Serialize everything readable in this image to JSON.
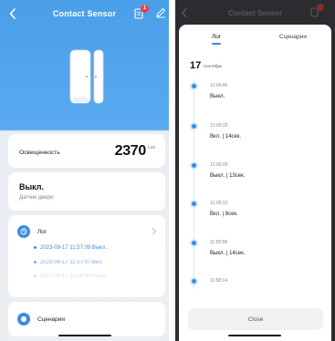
{
  "left": {
    "header": {
      "title": "Contact Sensor",
      "badge": "1"
    },
    "illuminance": {
      "label": "Освещенность",
      "value": "2370",
      "unit": "Lux"
    },
    "state": {
      "value": "Выкл.",
      "subtitle": "Датчик двери"
    },
    "log": {
      "label": "Лог",
      "entries": [
        "2023-09-17 11:57:09 Выкл.",
        "2023-09-17 11:57:07 Вкл.",
        "2023-09-17 11:56:50 Выкл."
      ]
    },
    "scenarios": {
      "label": "Сценарии"
    }
  },
  "right": {
    "dim_title": "Contact Sensor",
    "tabs": {
      "log": "Лог",
      "scenarios": "Сценарии"
    },
    "date": {
      "day": "17",
      "month": "Сентябрь"
    },
    "timeline": [
      {
        "time": "12:00:46",
        "text": "Выкл."
      },
      {
        "time": "12:00:33",
        "text": "Вкл. | 14сек."
      },
      {
        "time": "12:00:20",
        "text": "Выкл. | 13сек."
      },
      {
        "time": "12:00:12",
        "text": "Вкл. | 8сек."
      },
      {
        "time": "11:59:58",
        "text": "Выкл. | 14сек."
      },
      {
        "time": "11:58:14",
        "text": ""
      }
    ],
    "close_label": "Close"
  },
  "colors": {
    "accent": "#3b8de0",
    "header_gradient_top": "#4a9fe8",
    "badge": "#e8413a"
  },
  "icons": [
    "back-chevron-icon",
    "document-icon",
    "edit-pencil-icon",
    "clock-icon",
    "chevron-right-icon",
    "scenario-icon"
  ]
}
